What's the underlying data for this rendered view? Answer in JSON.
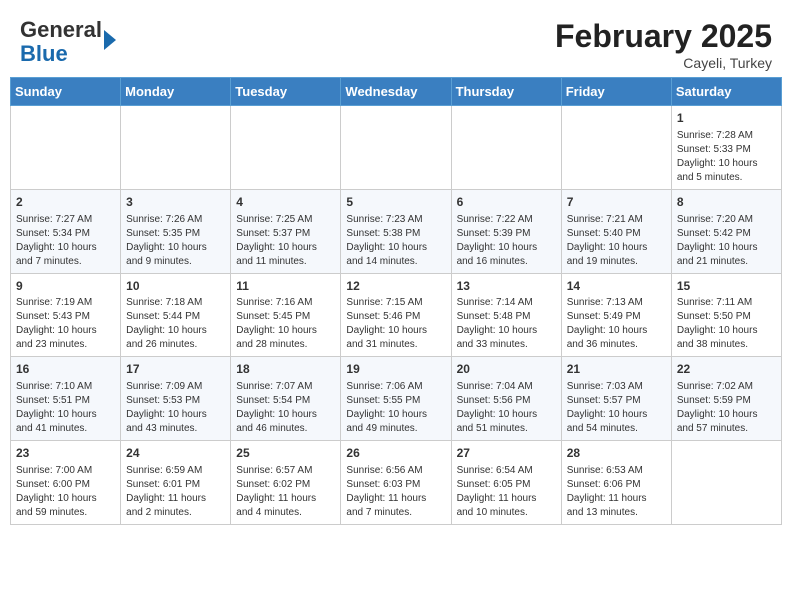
{
  "header": {
    "logo_general": "General",
    "logo_blue": "Blue",
    "month_title": "February 2025",
    "location": "Cayeli, Turkey"
  },
  "days_of_week": [
    "Sunday",
    "Monday",
    "Tuesday",
    "Wednesday",
    "Thursday",
    "Friday",
    "Saturday"
  ],
  "weeks": [
    [
      {
        "day": "",
        "info": ""
      },
      {
        "day": "",
        "info": ""
      },
      {
        "day": "",
        "info": ""
      },
      {
        "day": "",
        "info": ""
      },
      {
        "day": "",
        "info": ""
      },
      {
        "day": "",
        "info": ""
      },
      {
        "day": "1",
        "info": "Sunrise: 7:28 AM\nSunset: 5:33 PM\nDaylight: 10 hours\nand 5 minutes."
      }
    ],
    [
      {
        "day": "2",
        "info": "Sunrise: 7:27 AM\nSunset: 5:34 PM\nDaylight: 10 hours\nand 7 minutes."
      },
      {
        "day": "3",
        "info": "Sunrise: 7:26 AM\nSunset: 5:35 PM\nDaylight: 10 hours\nand 9 minutes."
      },
      {
        "day": "4",
        "info": "Sunrise: 7:25 AM\nSunset: 5:37 PM\nDaylight: 10 hours\nand 11 minutes."
      },
      {
        "day": "5",
        "info": "Sunrise: 7:23 AM\nSunset: 5:38 PM\nDaylight: 10 hours\nand 14 minutes."
      },
      {
        "day": "6",
        "info": "Sunrise: 7:22 AM\nSunset: 5:39 PM\nDaylight: 10 hours\nand 16 minutes."
      },
      {
        "day": "7",
        "info": "Sunrise: 7:21 AM\nSunset: 5:40 PM\nDaylight: 10 hours\nand 19 minutes."
      },
      {
        "day": "8",
        "info": "Sunrise: 7:20 AM\nSunset: 5:42 PM\nDaylight: 10 hours\nand 21 minutes."
      }
    ],
    [
      {
        "day": "9",
        "info": "Sunrise: 7:19 AM\nSunset: 5:43 PM\nDaylight: 10 hours\nand 23 minutes."
      },
      {
        "day": "10",
        "info": "Sunrise: 7:18 AM\nSunset: 5:44 PM\nDaylight: 10 hours\nand 26 minutes."
      },
      {
        "day": "11",
        "info": "Sunrise: 7:16 AM\nSunset: 5:45 PM\nDaylight: 10 hours\nand 28 minutes."
      },
      {
        "day": "12",
        "info": "Sunrise: 7:15 AM\nSunset: 5:46 PM\nDaylight: 10 hours\nand 31 minutes."
      },
      {
        "day": "13",
        "info": "Sunrise: 7:14 AM\nSunset: 5:48 PM\nDaylight: 10 hours\nand 33 minutes."
      },
      {
        "day": "14",
        "info": "Sunrise: 7:13 AM\nSunset: 5:49 PM\nDaylight: 10 hours\nand 36 minutes."
      },
      {
        "day": "15",
        "info": "Sunrise: 7:11 AM\nSunset: 5:50 PM\nDaylight: 10 hours\nand 38 minutes."
      }
    ],
    [
      {
        "day": "16",
        "info": "Sunrise: 7:10 AM\nSunset: 5:51 PM\nDaylight: 10 hours\nand 41 minutes."
      },
      {
        "day": "17",
        "info": "Sunrise: 7:09 AM\nSunset: 5:53 PM\nDaylight: 10 hours\nand 43 minutes."
      },
      {
        "day": "18",
        "info": "Sunrise: 7:07 AM\nSunset: 5:54 PM\nDaylight: 10 hours\nand 46 minutes."
      },
      {
        "day": "19",
        "info": "Sunrise: 7:06 AM\nSunset: 5:55 PM\nDaylight: 10 hours\nand 49 minutes."
      },
      {
        "day": "20",
        "info": "Sunrise: 7:04 AM\nSunset: 5:56 PM\nDaylight: 10 hours\nand 51 minutes."
      },
      {
        "day": "21",
        "info": "Sunrise: 7:03 AM\nSunset: 5:57 PM\nDaylight: 10 hours\nand 54 minutes."
      },
      {
        "day": "22",
        "info": "Sunrise: 7:02 AM\nSunset: 5:59 PM\nDaylight: 10 hours\nand 57 minutes."
      }
    ],
    [
      {
        "day": "23",
        "info": "Sunrise: 7:00 AM\nSunset: 6:00 PM\nDaylight: 10 hours\nand 59 minutes."
      },
      {
        "day": "24",
        "info": "Sunrise: 6:59 AM\nSunset: 6:01 PM\nDaylight: 11 hours\nand 2 minutes."
      },
      {
        "day": "25",
        "info": "Sunrise: 6:57 AM\nSunset: 6:02 PM\nDaylight: 11 hours\nand 4 minutes."
      },
      {
        "day": "26",
        "info": "Sunrise: 6:56 AM\nSunset: 6:03 PM\nDaylight: 11 hours\nand 7 minutes."
      },
      {
        "day": "27",
        "info": "Sunrise: 6:54 AM\nSunset: 6:05 PM\nDaylight: 11 hours\nand 10 minutes."
      },
      {
        "day": "28",
        "info": "Sunrise: 6:53 AM\nSunset: 6:06 PM\nDaylight: 11 hours\nand 13 minutes."
      },
      {
        "day": "",
        "info": ""
      }
    ]
  ]
}
